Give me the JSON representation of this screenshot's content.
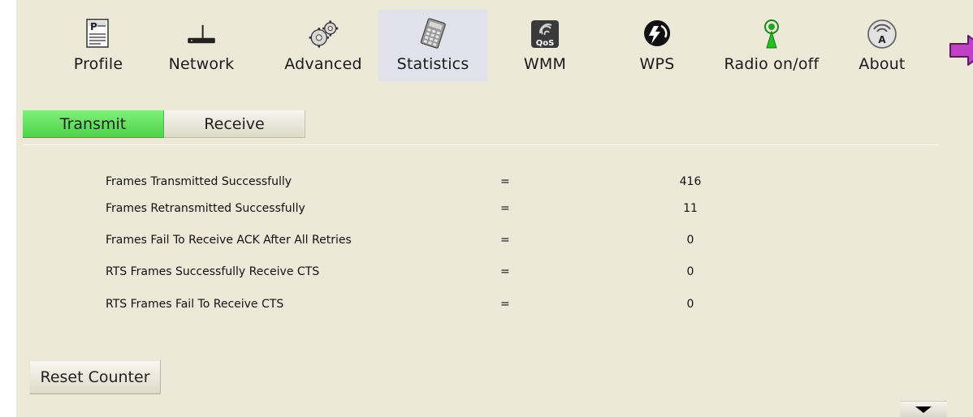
{
  "toolbar": {
    "items": [
      {
        "label": "Profile",
        "icon": "profile-icon"
      },
      {
        "label": "Network",
        "icon": "network-icon"
      },
      {
        "label": "Advanced",
        "icon": "advanced-icon"
      },
      {
        "label": "Statistics",
        "icon": "statistics-icon",
        "active": true
      },
      {
        "label": "WMM",
        "icon": "wmm-icon",
        "icon_text": "QoS"
      },
      {
        "label": "WPS",
        "icon": "wps-icon"
      },
      {
        "label": "Radio on/off",
        "icon": "radio-icon"
      },
      {
        "label": "About",
        "icon": "about-icon",
        "icon_text": "A"
      }
    ]
  },
  "tabs": [
    {
      "label": "Transmit",
      "active": true
    },
    {
      "label": "Receive",
      "active": false
    }
  ],
  "stats": [
    {
      "name": "Frames Transmitted Successfully",
      "eq": "=",
      "value": "416"
    },
    {
      "name": "Frames Retransmitted Successfully",
      "eq": "=",
      "value": "11"
    },
    {
      "name": "Frames Fail To Receive ACK After All Retries",
      "eq": "=",
      "value": "0"
    },
    {
      "name": "RTS Frames Successfully Receive CTS",
      "eq": "=",
      "value": "0"
    },
    {
      "name": "RTS Frames Fail To Receive CTS",
      "eq": "=",
      "value": "0"
    }
  ],
  "reset_label": "Reset Counter",
  "colors": {
    "background": "#ece9d8",
    "active_tab": "#5ee059",
    "arrow": "#c040c8"
  }
}
